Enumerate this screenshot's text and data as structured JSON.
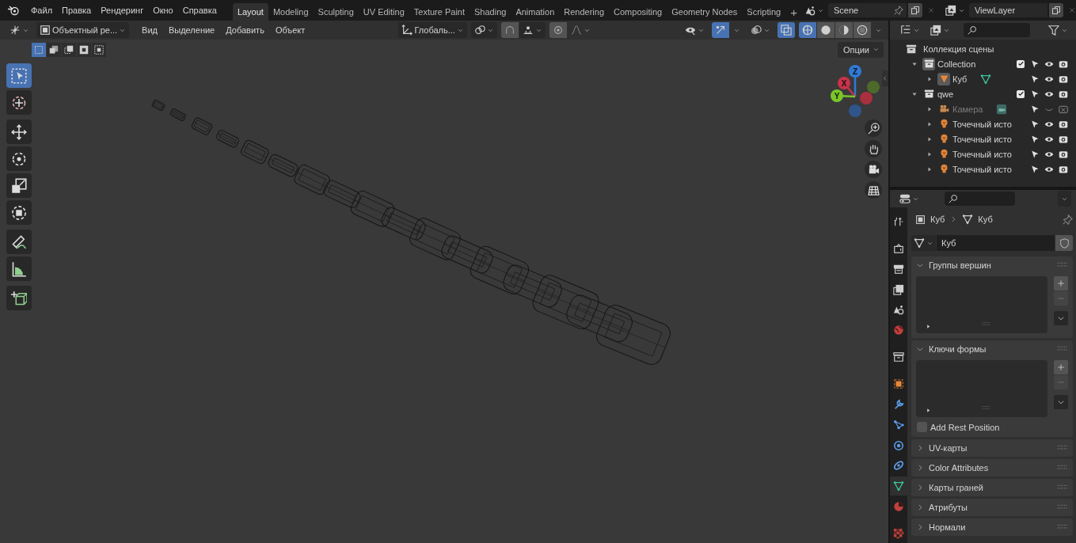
{
  "menu": [
    "Файл",
    "Правка",
    "Рендеринг",
    "Окно",
    "Справка"
  ],
  "workspaces": [
    {
      "label": "Layout",
      "selected": true
    },
    {
      "label": "Modeling",
      "selected": false
    },
    {
      "label": "Sculpting",
      "selected": false
    },
    {
      "label": "UV Editing",
      "selected": false
    },
    {
      "label": "Texture Paint",
      "selected": false
    },
    {
      "label": "Shading",
      "selected": false
    },
    {
      "label": "Animation",
      "selected": false
    },
    {
      "label": "Rendering",
      "selected": false
    },
    {
      "label": "Compositing",
      "selected": false
    },
    {
      "label": "Geometry Nodes",
      "selected": false
    },
    {
      "label": "Scripting",
      "selected": false
    }
  ],
  "add_workspace": "+",
  "scene": "Scene",
  "view_layer": "ViewLayer",
  "viewport": {
    "mode": "Объектный ре...",
    "menus": [
      "Вид",
      "Выделение",
      "Добавить",
      "Объект"
    ],
    "orientation": "Глобаль...",
    "options": "Опции",
    "gizmos_on": true,
    "xray_on": true,
    "select_modes": [
      {
        "selected": true
      },
      {
        "selected": false
      },
      {
        "selected": false
      },
      {
        "selected": false
      },
      {
        "selected": false
      }
    ],
    "shading": [
      {
        "kind": "wireframe",
        "selected": true
      },
      {
        "kind": "solid",
        "selected": false
      },
      {
        "kind": "material",
        "selected": false
      },
      {
        "kind": "rendered",
        "selected": false
      }
    ],
    "tools": [
      {
        "kind": "select",
        "selected": true
      },
      {
        "kind": "cursor",
        "selected": false
      },
      {
        "kind": "move",
        "selected": false
      },
      {
        "kind": "rotate",
        "selected": false
      },
      {
        "kind": "scale",
        "selected": false
      },
      {
        "kind": "transform",
        "selected": false
      },
      {
        "kind": "annotate",
        "selected": false
      },
      {
        "kind": "measure",
        "selected": false
      },
      {
        "kind": "add_cube",
        "selected": false
      }
    ],
    "axes": [
      {
        "kind": "z",
        "label": "Z",
        "color": "#2e7ad6"
      },
      {
        "kind": "x",
        "label": "X",
        "color": "#c8334a"
      },
      {
        "kind": "y",
        "label": "Y",
        "color": "#7bc52a"
      },
      {
        "kind": "neg_y",
        "color": "#4e6a2a"
      },
      {
        "kind": "neg_x",
        "color": "#a8303f"
      },
      {
        "kind": "neg_z",
        "color": "#2f558a"
      }
    ]
  },
  "outliner": {
    "root": "Коллекция сцены",
    "items": [
      {
        "name": "Collection",
        "kind": "collection",
        "active": true,
        "expanded": true,
        "checked": true,
        "hidden": false,
        "children": [
          {
            "name": "Куб",
            "kind": "mesh",
            "active": true,
            "expanded": false,
            "hidden": false
          }
        ]
      },
      {
        "name": "qwe",
        "kind": "collection",
        "active": false,
        "expanded": true,
        "checked": true,
        "hidden": false,
        "children": [
          {
            "name": "Камера",
            "kind": "camera",
            "active": false,
            "expanded": false,
            "hidden": true
          },
          {
            "name": "Точечный исто",
            "kind": "light",
            "active": false,
            "expanded": false,
            "hidden": false
          },
          {
            "name": "Точечный исто",
            "kind": "light",
            "active": false,
            "expanded": false,
            "hidden": false
          },
          {
            "name": "Точечный исто",
            "kind": "light",
            "active": false,
            "expanded": false,
            "hidden": false
          },
          {
            "name": "Точечный исто",
            "kind": "light",
            "active": false,
            "expanded": false,
            "hidden": false
          }
        ]
      }
    ]
  },
  "properties": {
    "breadcrumb": [
      "Куб",
      "Куб"
    ],
    "datablock": "Куб",
    "tabs": [
      {
        "kind": "tool",
        "selected": false
      },
      {
        "kind": "render",
        "selected": false
      },
      {
        "kind": "output",
        "selected": false
      },
      {
        "kind": "view_layer",
        "selected": false
      },
      {
        "kind": "scene",
        "selected": false
      },
      {
        "kind": "world",
        "selected": false
      },
      {
        "kind": "collection",
        "selected": false
      },
      {
        "kind": "object",
        "selected": false
      },
      {
        "kind": "modifiers",
        "selected": false
      },
      {
        "kind": "particles",
        "selected": false
      },
      {
        "kind": "physics",
        "selected": false
      },
      {
        "kind": "constraints",
        "selected": false
      },
      {
        "kind": "data",
        "selected": true
      },
      {
        "kind": "material",
        "selected": false
      },
      {
        "kind": "texture",
        "selected": false
      }
    ],
    "panels": [
      {
        "title": "Группы вершин",
        "expanded": true
      },
      {
        "title": "Ключи формы",
        "expanded": true,
        "option": {
          "label": "Add Rest Position",
          "checked": false
        }
      },
      {
        "title": "UV-карты",
        "expanded": false
      },
      {
        "title": "Color Attributes",
        "expanded": false
      },
      {
        "title": "Карты граней",
        "expanded": false
      },
      {
        "title": "Атрибуты",
        "expanded": false
      },
      {
        "title": "Нормали",
        "expanded": false
      }
    ]
  }
}
